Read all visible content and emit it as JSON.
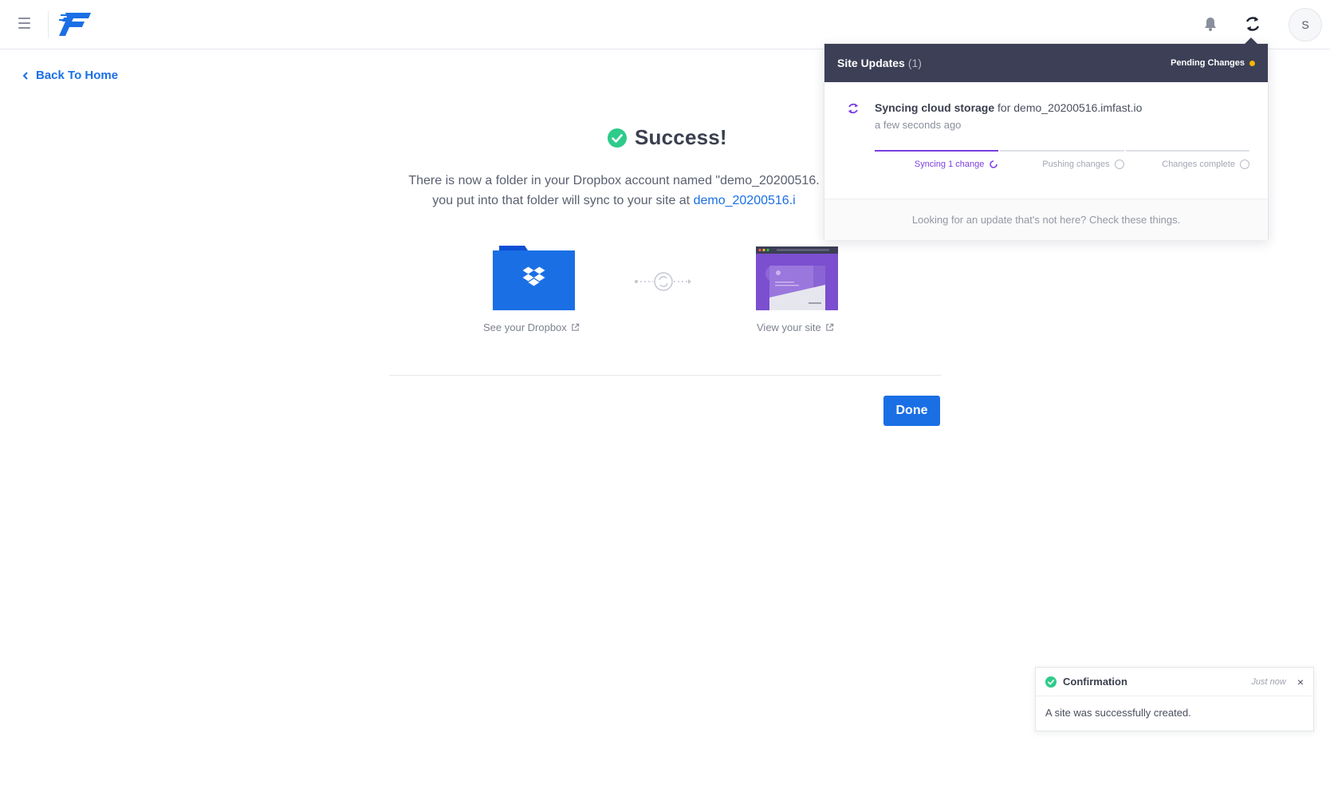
{
  "header": {
    "menu_icon": "hamburger-icon",
    "logo": "fast-f-logo",
    "bell_icon": "bell-icon",
    "sync_icon": "sync-icon",
    "avatar_initial": "S"
  },
  "nav": {
    "back_label": "Back To Home"
  },
  "main": {
    "title": "Success!",
    "desc_line1": "There is now a folder in your Dropbox account named \"demo_20200516.",
    "desc_line2_prefix": "you put into that folder will sync to your site at ",
    "desc_line2_link": "demo_20200516.i",
    "dropbox_caption": "See your Dropbox",
    "site_caption": "View your site",
    "done_label": "Done"
  },
  "site_updates": {
    "title": "Site Updates",
    "count": "(1)",
    "pending_label": "Pending Changes",
    "item_action": "Syncing cloud storage",
    "item_for": "for demo_20200516.imfast.io",
    "item_time": "a few seconds ago",
    "steps": [
      {
        "label": "Syncing 1 change",
        "state": "active"
      },
      {
        "label": "Pushing changes",
        "state": "pending"
      },
      {
        "label": "Changes complete",
        "state": "pending"
      }
    ],
    "footer": "Looking for an update that's not here? Check these things."
  },
  "toast": {
    "title": "Confirmation",
    "time": "Just now",
    "close": "×",
    "message": "A site was successfully created."
  },
  "colors": {
    "accent": "#1a6fe5",
    "success": "#2ecb8a",
    "header_dark": "#3c3f55",
    "progress": "#7b3fe0",
    "pending_dot": "#f7b500"
  }
}
